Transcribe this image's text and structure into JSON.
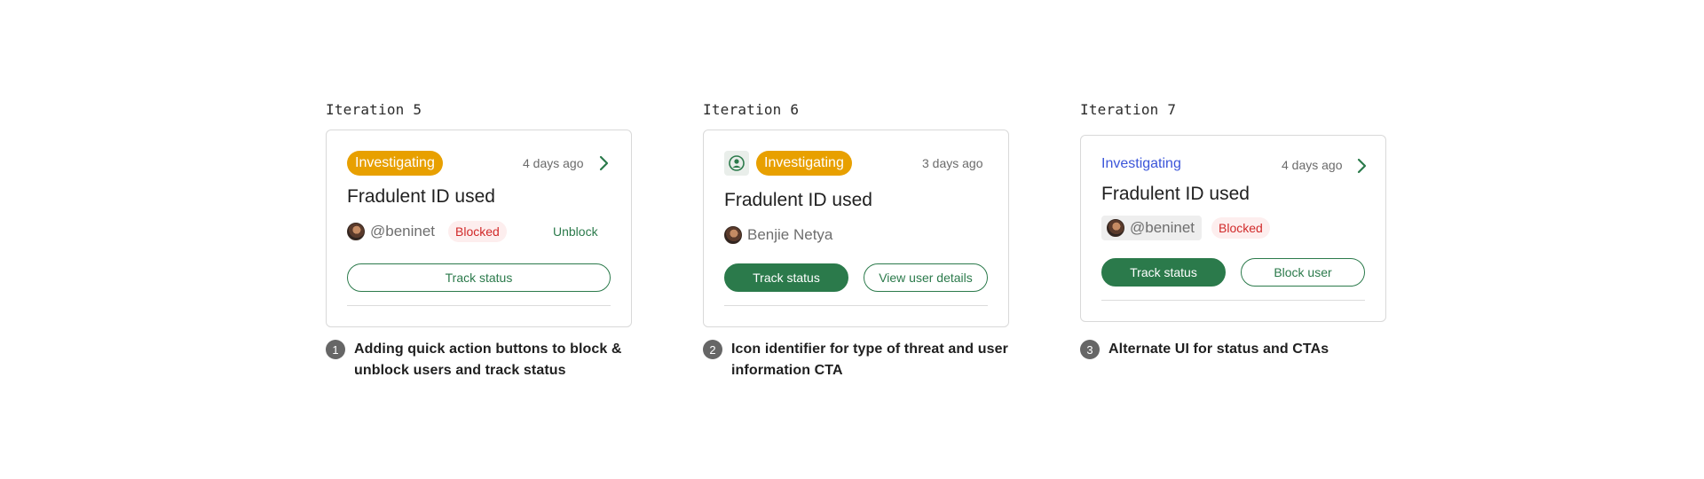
{
  "iterations": [
    {
      "title": "Iteration 5",
      "status": "Investigating",
      "time": "4 days ago",
      "heading": "Fradulent ID used",
      "user": "@beninet",
      "badge": "Blocked",
      "action_link": "Unblock",
      "primary_button": "Track status",
      "note_number": "1",
      "note": "Adding quick action buttons to block & unblock users and track status"
    },
    {
      "title": "Iteration 6",
      "status": "Investigating",
      "time": "3 days ago",
      "heading": "Fradulent ID used",
      "user": "Benjie Netya",
      "primary_button": "Track status",
      "secondary_button": "View user details",
      "note_number": "2",
      "note": "Icon identifier for type of threat and user information CTA"
    },
    {
      "title": "Iteration 7",
      "status": "Investigating",
      "time": "4 days ago",
      "heading": "Fradulent ID used",
      "user": "@beninet",
      "badge": "Blocked",
      "primary_button": "Track status",
      "secondary_button": "Block user",
      "note_number": "3",
      "note": "Alternate UI for status and CTAs"
    }
  ],
  "colors": {
    "status_pill": "#e8a000",
    "status_text_alt": "#3b55d9",
    "brand_green": "#2b7a4b",
    "blocked_red": "#d12a2a",
    "blocked_bg": "#fdeeee"
  },
  "icons": {
    "chevron": "chevron-right-icon",
    "threat": "threat-type-icon",
    "avatar": "user-avatar"
  }
}
